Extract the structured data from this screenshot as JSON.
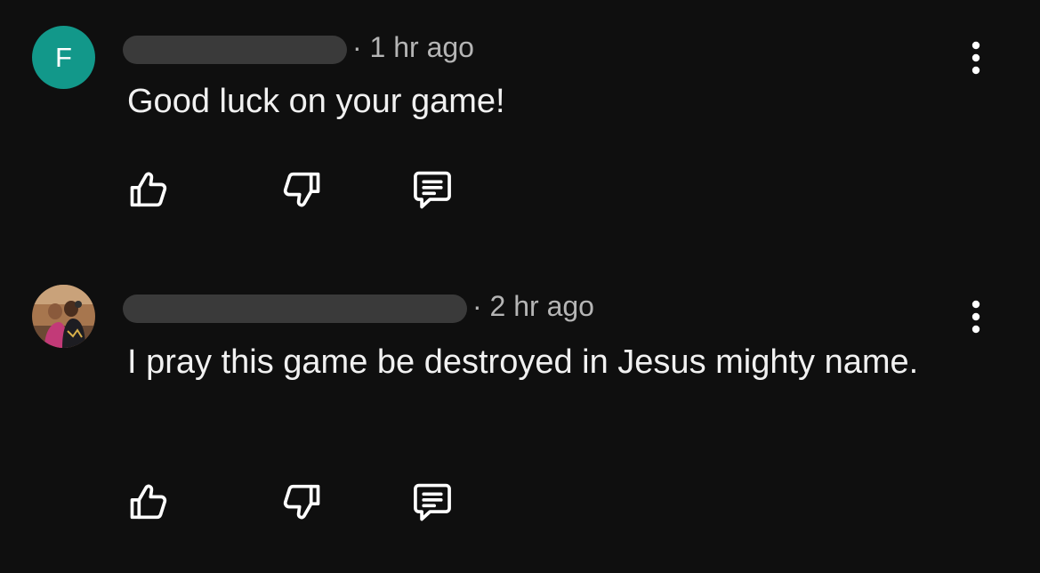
{
  "comments": [
    {
      "avatar_letter": "F",
      "avatar_color": "#12988a",
      "author_redacted": true,
      "timestamp": "· 1 hr ago",
      "text": "Good luck on your game!",
      "icons": {
        "like": "thumbs-up-icon",
        "dislike": "thumbs-down-icon",
        "reply": "reply-comment-icon",
        "more": "more-vertical-icon"
      }
    },
    {
      "avatar_type": "photo",
      "author_redacted": true,
      "timestamp": "· 2 hr ago",
      "text": "I pray this game be destroyed in Jesus mighty name.",
      "icons": {
        "like": "thumbs-up-icon",
        "dislike": "thumbs-down-icon",
        "reply": "reply-comment-icon",
        "more": "more-vertical-icon"
      }
    }
  ],
  "colors": {
    "background": "#0f0f0f",
    "text_primary": "#f1f1f1",
    "text_secondary": "#b5b5b5",
    "redaction": "#3a3a3a"
  }
}
